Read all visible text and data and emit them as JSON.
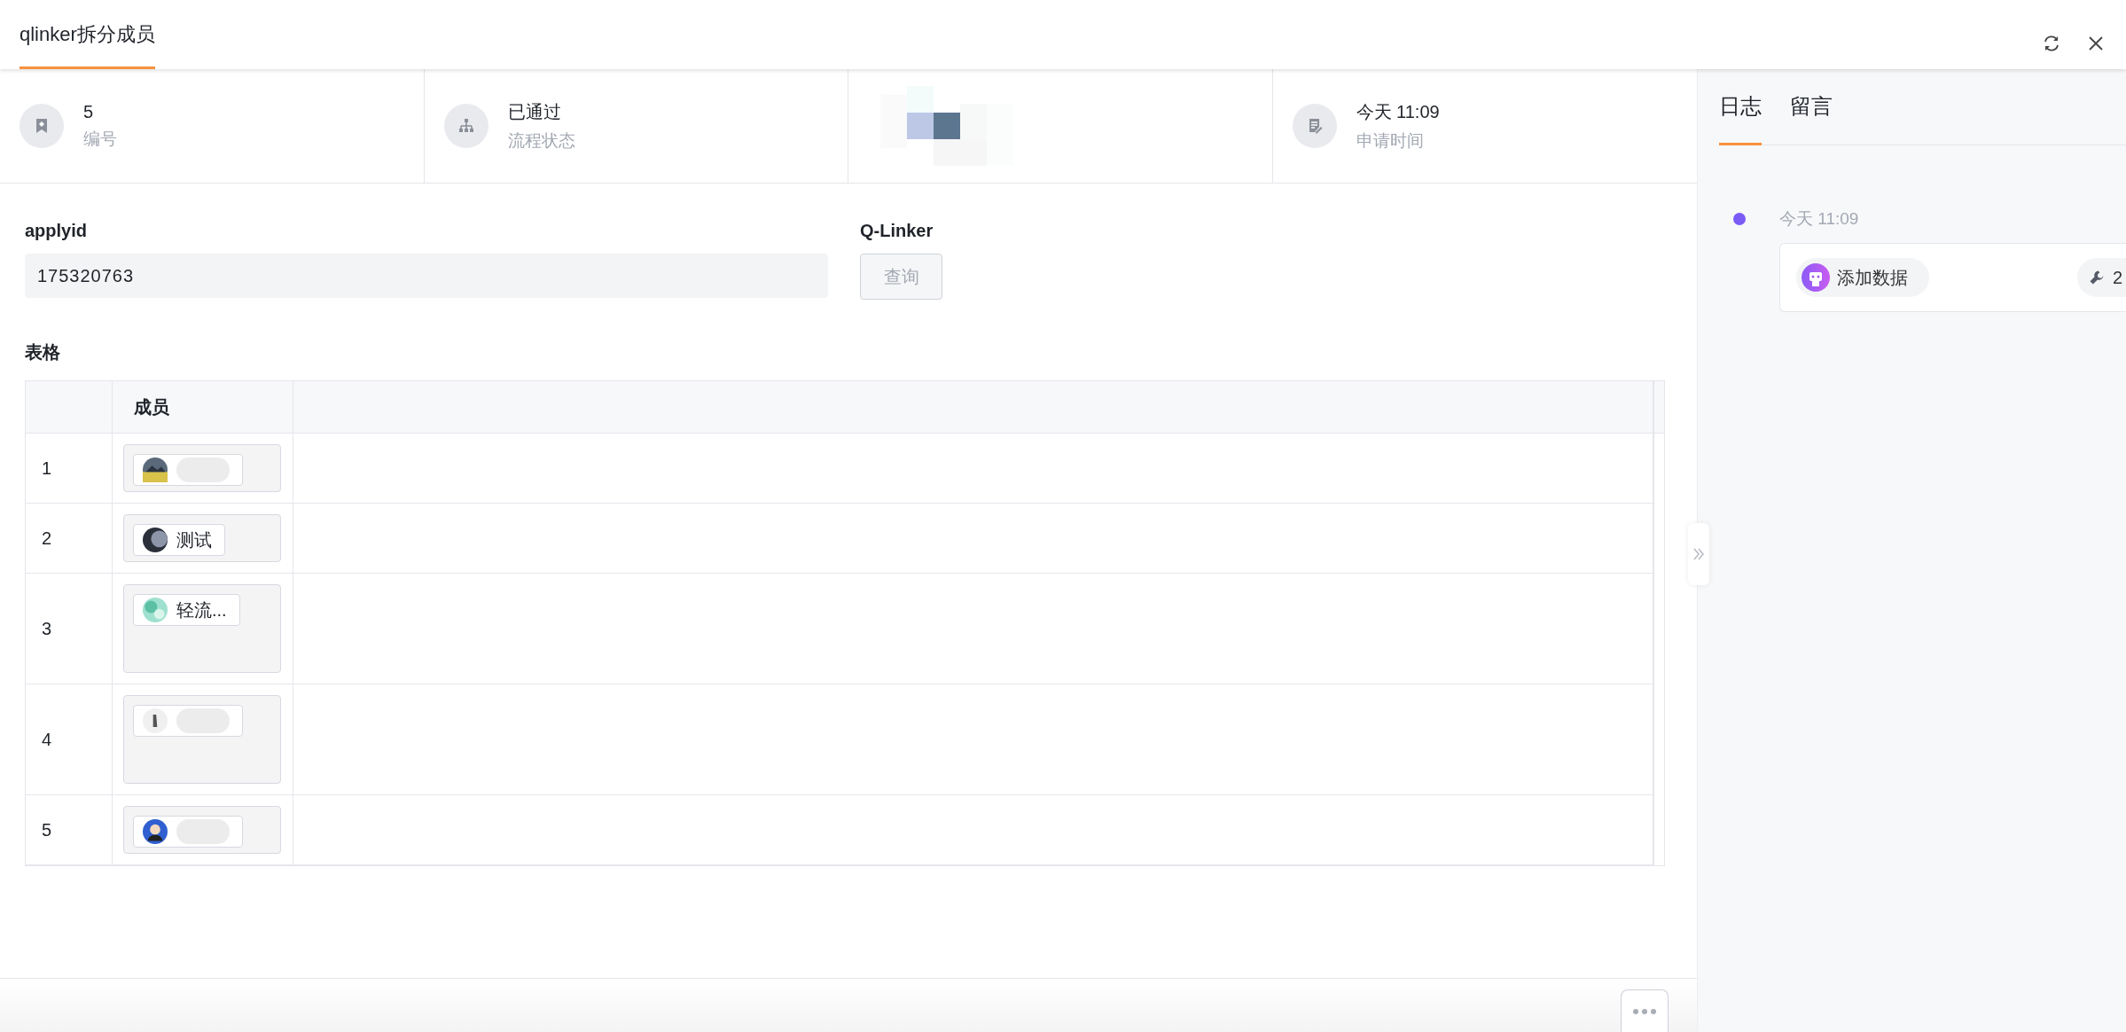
{
  "header": {
    "title": "qlinker拆分成员"
  },
  "info": [
    {
      "kind": "number",
      "value": "5",
      "label": "编号"
    },
    {
      "kind": "flow",
      "value": "已通过",
      "label": "流程状态"
    },
    {
      "kind": "blurred"
    },
    {
      "kind": "time",
      "value": "今天 11:09",
      "label": "申请时间"
    }
  ],
  "form": {
    "field": {
      "label": "applyid",
      "value": "175320763"
    },
    "query": {
      "label": "Q-Linker",
      "button": "查询",
      "disabled": true
    }
  },
  "table": {
    "title": "表格",
    "columns": [
      "成员"
    ],
    "rows": [
      {
        "index": "1",
        "kind": "single"
      },
      {
        "index": "2",
        "kind": "single",
        "member": {
          "kind": "picture",
          "name": "测试"
        }
      },
      {
        "index": "3",
        "kind": "multi",
        "member": {
          "kind": "picture",
          "name": "轻流..."
        }
      },
      {
        "index": "4",
        "kind": "multi"
      },
      {
        "index": "5",
        "kind": "single"
      }
    ]
  },
  "log": {
    "tabs": [
      {
        "label": "日志",
        "selected": true
      },
      {
        "label": "留言",
        "selected": false
      }
    ],
    "entries": [
      {
        "time": "今天 11:09",
        "action": "添加数据",
        "count": "2"
      }
    ]
  }
}
